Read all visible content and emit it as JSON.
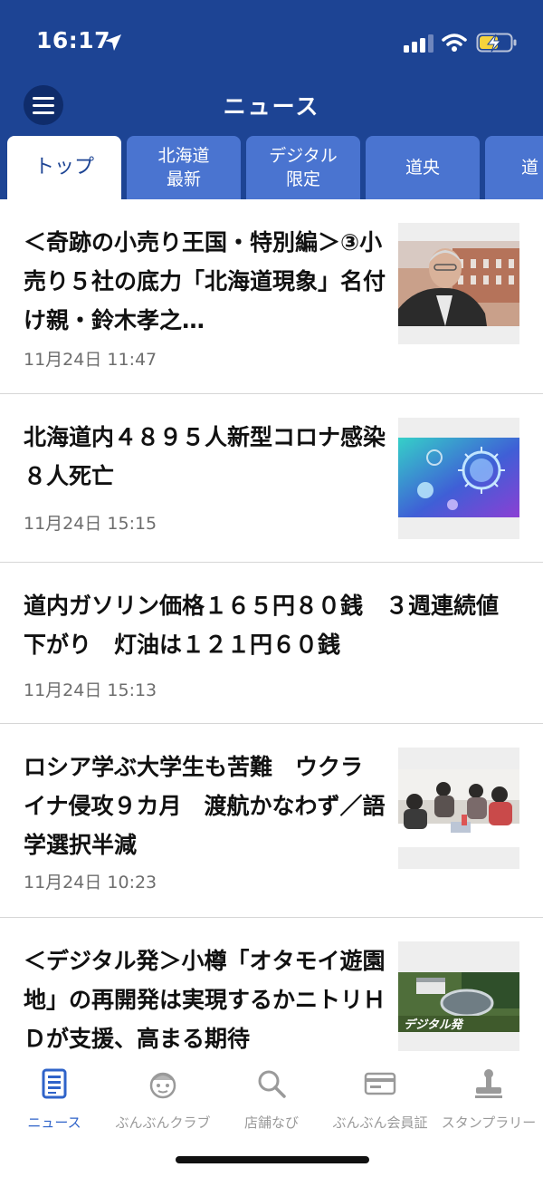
{
  "status": {
    "time": "16:17"
  },
  "header": {
    "title": "ニュース"
  },
  "tabs": [
    {
      "label": "トップ",
      "active": true
    },
    {
      "label": "北海道\n最新"
    },
    {
      "label": "デジタル\n限定"
    },
    {
      "label": "道央"
    },
    {
      "label": "道"
    }
  ],
  "articles": [
    {
      "title": "＜奇跡の小売り王国・特別編＞③小売り５社の底力「北海道現象」名付け親・鈴木孝之…",
      "date": "11月24日 11:47",
      "thumb": "man-portrait-red-brick-building"
    },
    {
      "title": "北海道内４８９５人新型コロナ感染　８人死亡",
      "date": "11月24日 15:15",
      "thumb": "virus-illustration"
    },
    {
      "title": "道内ガソリン価格１６５円８０銭　３週連続値下がり　灯油は１２１円６０銭",
      "date": "11月24日 15:13",
      "thumb": ""
    },
    {
      "title": "ロシア学ぶ大学生も苦難　ウクライナ侵攻９カ月　渡航かなわず／語学選択半減",
      "date": "11月24日 10:23",
      "thumb": "students-at-table"
    },
    {
      "title": "＜デジタル発＞小樽「オタモイ遊園地」の再開発は実現するかニトリＨＤが支援、高まる期待",
      "date": "",
      "thumb": "aerial-site-view",
      "thumb_caption": "デジタル発"
    }
  ],
  "bottom_nav": [
    {
      "label": "ニュース",
      "icon": "newspaper-icon",
      "active": true
    },
    {
      "label": "ぶんぶんクラブ",
      "icon": "mascot-icon"
    },
    {
      "label": "店舗なび",
      "icon": "search-icon"
    },
    {
      "label": "ぶんぶん会員証",
      "icon": "member-card-icon"
    },
    {
      "label": "スタンプラリー",
      "icon": "stamp-icon"
    }
  ],
  "colors": {
    "header": "#1d4494",
    "tab": "#4a74d0",
    "active_nav": "#2f63c9"
  }
}
